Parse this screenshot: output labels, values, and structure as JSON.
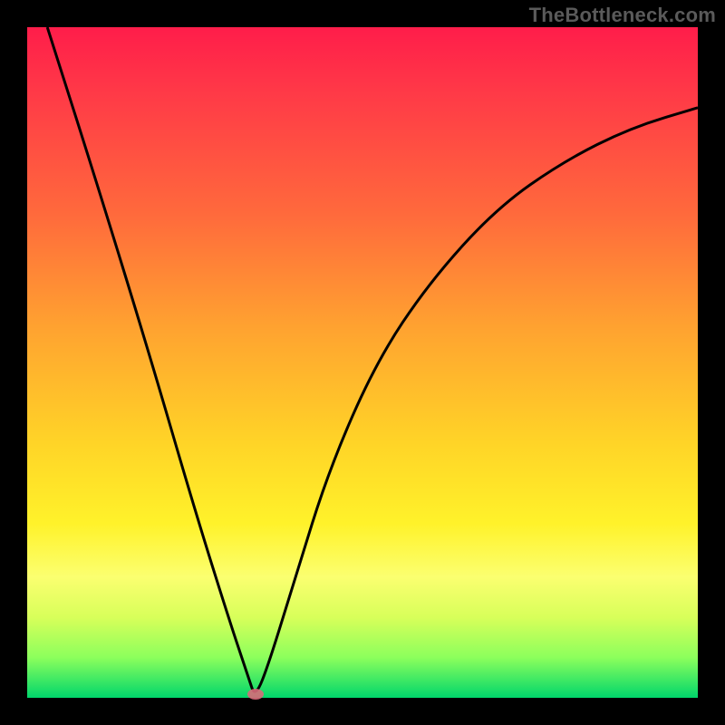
{
  "watermark": "TheBottleneck.com",
  "chart_data": {
    "type": "line",
    "title": "",
    "xlabel": "",
    "ylabel": "",
    "xlim": [
      0,
      1
    ],
    "ylim": [
      0,
      1
    ],
    "series": [
      {
        "name": "curve",
        "x": [
          0.03,
          0.1,
          0.18,
          0.25,
          0.3,
          0.33,
          0.34,
          0.36,
          0.4,
          0.45,
          0.52,
          0.6,
          0.7,
          0.8,
          0.9,
          1.0
        ],
        "y": [
          1.0,
          0.78,
          0.52,
          0.28,
          0.12,
          0.03,
          0.0,
          0.05,
          0.18,
          0.34,
          0.5,
          0.62,
          0.73,
          0.8,
          0.85,
          0.88
        ]
      }
    ],
    "marker": {
      "x": 0.34,
      "y": 0.0
    },
    "gradient_stops": [
      {
        "pos": 0.0,
        "color": "#ff1d4a"
      },
      {
        "pos": 0.28,
        "color": "#ff6a3c"
      },
      {
        "pos": 0.62,
        "color": "#ffd427"
      },
      {
        "pos": 0.82,
        "color": "#fbff70"
      },
      {
        "pos": 1.0,
        "color": "#00d66b"
      }
    ]
  }
}
